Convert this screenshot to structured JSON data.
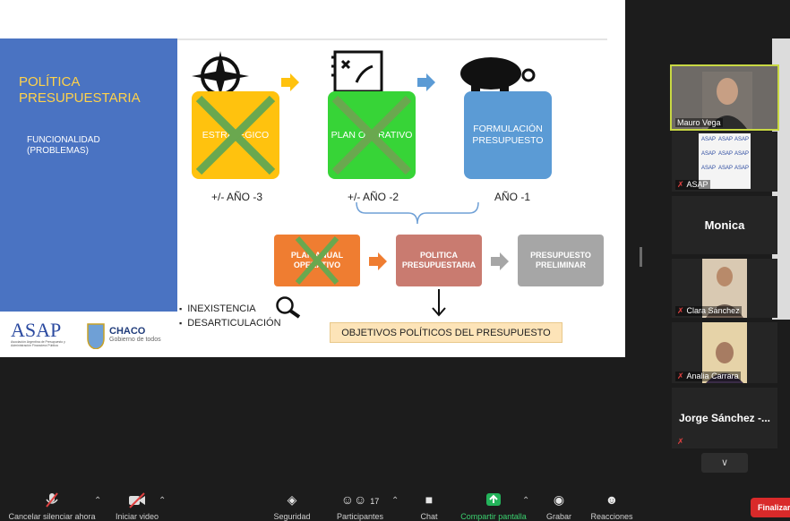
{
  "slide": {
    "panel_title": "POLÍTICA PRESUPUESTARIA",
    "panel_subtitle": "FUNCIONALIDAD (PROBLEMAS)",
    "box1_label": "ESTRATÉGICO",
    "box2_label": "PLAN OPERATIVO",
    "box3_label": "FORMULACIÓN PRESUPUESTO",
    "year1": "+/- AÑO -3",
    "year2": "+/- AÑO -2",
    "year3": "AÑO -1",
    "small1": "PLAN ANUAL OPERATIVO",
    "small2": "POLITICA PRESUPUESTARIA",
    "small3": "PRESUPUESTO PRELIMINAR",
    "bullet1": "INEXISTENCIA",
    "bullet2": "DESARTICULACIÓN",
    "objetivos": "OBJETIVOS POLÍTICOS DEL PRESUPUESTO",
    "asap_logo": "ASAP",
    "asap_sub": "Asociación Argentina de Presupuesto y Administración Financiera Pública",
    "chaco_logo": "CHACO",
    "chaco_sub": "Gobierno de todos",
    "colors": {
      "blue": "#4a73c2",
      "yellow": "#ffc20e",
      "green": "#37d437",
      "orange": "#ef7d31",
      "salmon": "#c97b70",
      "gray": "#a6a6a6"
    }
  },
  "participants": [
    {
      "name": "Mauro Vega",
      "type": "video",
      "muted": false
    },
    {
      "name": "ASAP",
      "type": "logo",
      "muted": true
    },
    {
      "name": "Monica",
      "type": "name",
      "muted": false
    },
    {
      "name": "Clara Sánchez",
      "type": "video",
      "muted": true
    },
    {
      "name": "Analia Carrara",
      "type": "video",
      "muted": true
    },
    {
      "name": "Jorge Sánchez -...",
      "type": "name",
      "muted": true
    }
  ],
  "toolbar": {
    "unmute": "Cancelar silenciar ahora",
    "video": "Iniciar video",
    "security": "Seguridad",
    "participants": "Participantes",
    "participants_count": "17",
    "chat": "Chat",
    "share": "Compartir pantalla",
    "record": "Grabar",
    "reactions": "Reacciones",
    "end": "Finalizar"
  }
}
